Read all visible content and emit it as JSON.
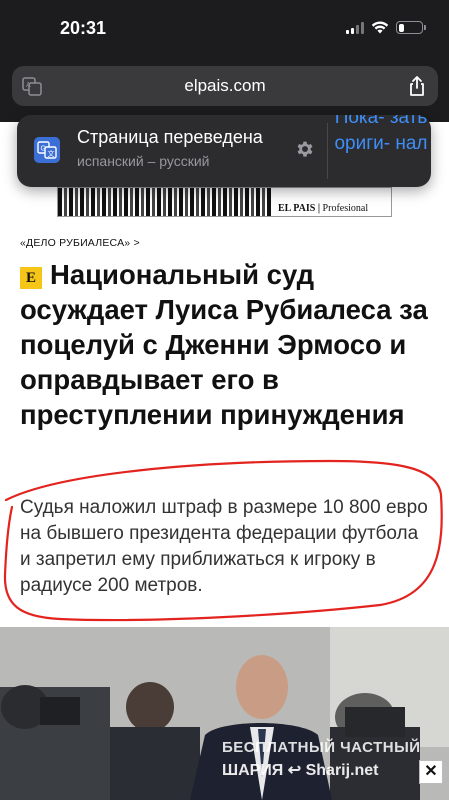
{
  "status_bar": {
    "time": "20:31"
  },
  "browser": {
    "url": "elpais.com"
  },
  "translation_banner": {
    "title": "Страница переведена",
    "languages": "испанский – русский",
    "show_original_label": "Пока- зать ориги- нал"
  },
  "ad": {
    "brand": "EL PAIS",
    "brand_suffix": "Profesional"
  },
  "article": {
    "breadcrumb": "«ДЕЛО РУБИАЛЕСА» >",
    "badge": "E",
    "headline": "Национальный суд осуждает Луиса Рубиалеса за поцелуй с Дженни Эрмосо и оправдывает его в преступлении принуждения",
    "subheadline": "Судья наложил штраф в размере 10 800 евро на бывшего президента федерации футбола и запретил ему приближаться к игроку в радиусе 200 метров."
  },
  "photo": {
    "watermark_line1": "БЕСПЛАТНЫЙ ЧАСТНЫЙ",
    "watermark_line2": "ШАРИЯ ↩ Sharij.net",
    "close_label": "✕"
  },
  "colors": {
    "accent_blue": "#3e8ef7",
    "chrome_bg": "#1c1c1e",
    "annotation_red": "#e3231e",
    "badge_yellow": "#f5c518"
  }
}
